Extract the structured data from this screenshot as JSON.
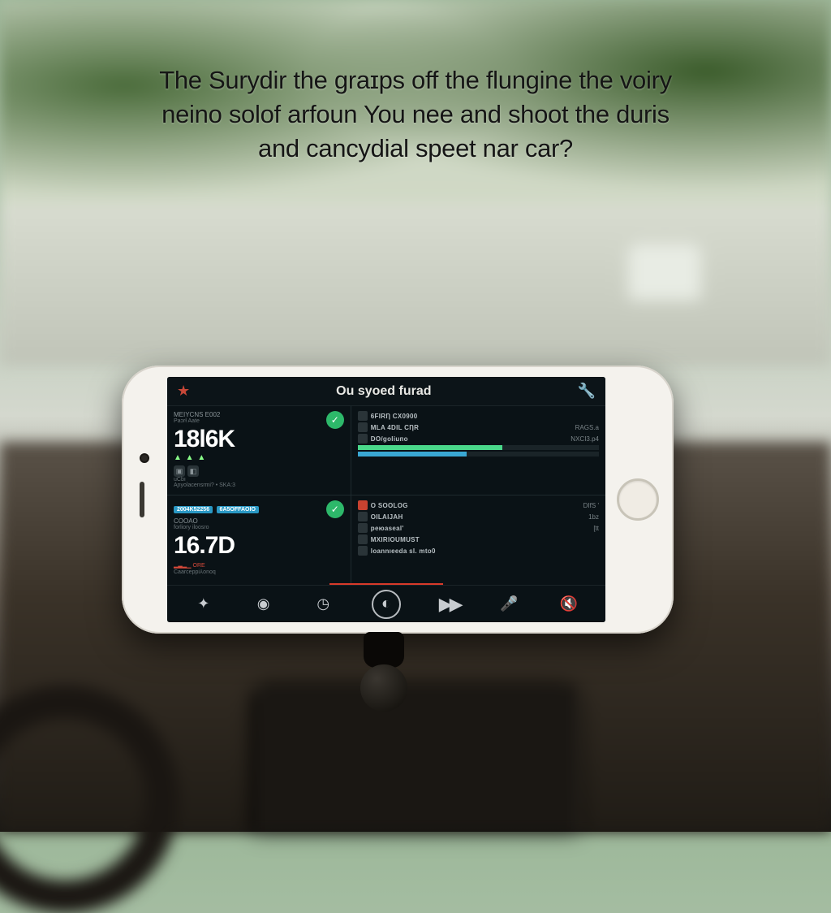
{
  "headline": {
    "line1": "The Surydir the graɪps off the flungine the voiry",
    "line2": "neino solof arfoun You nee and shoot the duris",
    "line3": "and cancydial speet nar car?"
  },
  "app": {
    "title": "Ou syoed furad",
    "panels": {
      "topLeft": {
        "label": "MEiYcns e002",
        "sub": "Paɔrł Aate",
        "big": "18l6K",
        "extra": "uCbı",
        "foot": "Aɲyolacensrmi? • SKA:3"
      },
      "bottomLeft": {
        "label": "COOAO",
        "sub": "forliory iloosro",
        "big": "16.7D",
        "tag1": "2004K52256",
        "tag2": "6A5OFFAOIO",
        "extra": "ORE",
        "foot": "Caarceppi⅄onoq"
      },
      "topRight": {
        "rows": [
          {
            "lbl": "6FIRȠ CX0900",
            "val": "",
            "sub": ""
          },
          {
            "lbl": "MLA 4DIL CȠR",
            "val": "RAGS.a",
            "sub": ""
          },
          {
            "lbl": "DO/goliuпo",
            "val": "NXCI3.p4",
            "sub": ""
          }
        ]
      },
      "bottomRight": {
        "rows": [
          {
            "lbl": "O SOOLOG",
            "val": "DIfS '",
            "sub": ""
          },
          {
            "lbl": "OILAlJAH",
            "val": "1bz",
            "sub": ""
          },
          {
            "lbl": "peюaseal'",
            "val": "[tt",
            "sub": ""
          },
          {
            "lbl": "MXIRIOUMUST",
            "val": "",
            "sub": ""
          },
          {
            "lbl": "loannıeeda sl. mto0",
            "val": "",
            "sub": ""
          }
        ]
      }
    },
    "toolbar": {
      "share": "share",
      "camera": "camera",
      "gauge": "gauge",
      "mic": "mic",
      "ff": "fast-forward",
      "voice": "voice",
      "mute": "mute"
    }
  }
}
